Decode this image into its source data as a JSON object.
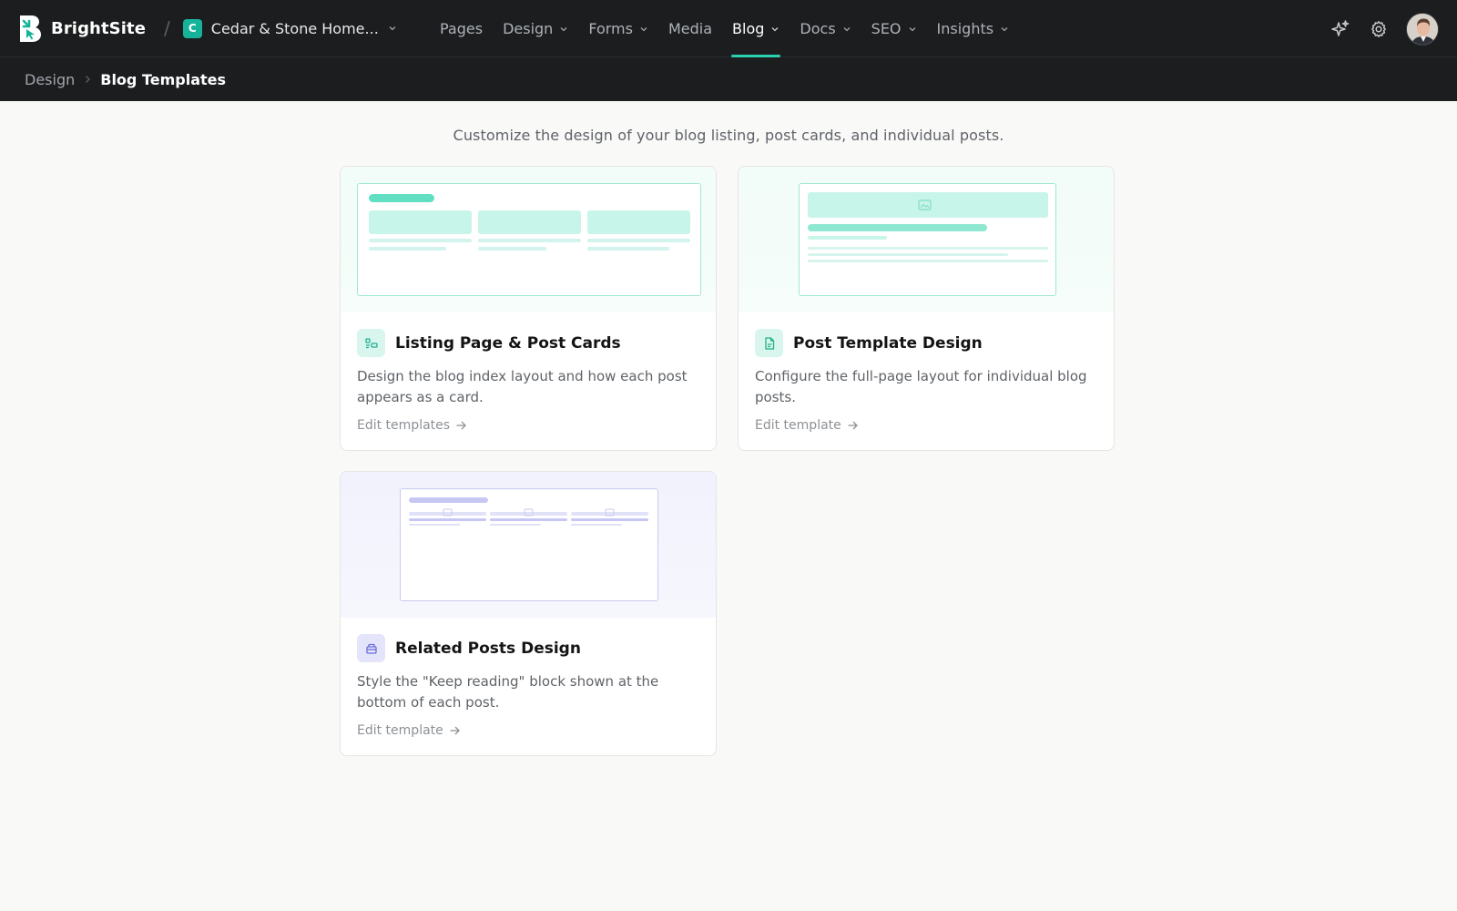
{
  "brand": {
    "name": "BrightSite",
    "badge_letter": "C",
    "workspace": "Cedar & Stone Home..."
  },
  "nav": {
    "items": [
      {
        "label": "Pages"
      },
      {
        "label": "Design"
      },
      {
        "label": "Forms"
      },
      {
        "label": "Media"
      },
      {
        "label": "Blog"
      },
      {
        "label": "Docs"
      },
      {
        "label": "SEO"
      },
      {
        "label": "Insights"
      }
    ],
    "active": "Blog"
  },
  "topbar_icons": [
    "sparkles-icon",
    "gear-icon",
    "avatar"
  ],
  "breadcrumb": {
    "parent": "Design",
    "current": "Blog Templates"
  },
  "page": {
    "subtitle": "Customize the design of your blog listing, post cards, and individual posts."
  },
  "cards": [
    {
      "title": "Listing Page & Post Cards",
      "description": "Design the blog index layout and how each post appears as a card.",
      "link": "Edit templates",
      "icon": "layout-cards-icon",
      "accent": "#2ad0b0"
    },
    {
      "title": "Post Template Design",
      "description": "Configure the full-page layout for individual blog posts.",
      "link": "Edit template",
      "icon": "document-icon",
      "accent": "#22c58b"
    },
    {
      "title": "Related Posts Design",
      "description": "Style the \"Keep reading\" block shown at the bottom of each post.",
      "link": "Edit template",
      "icon": "stack-icon",
      "accent": "#7b7fe0"
    }
  ],
  "colors": {
    "topbar": "#1b1d1f",
    "accent_teal": "#2ad0b0",
    "accent_purple": "#7b7fe0",
    "page_bg": "#f9f9f8"
  }
}
